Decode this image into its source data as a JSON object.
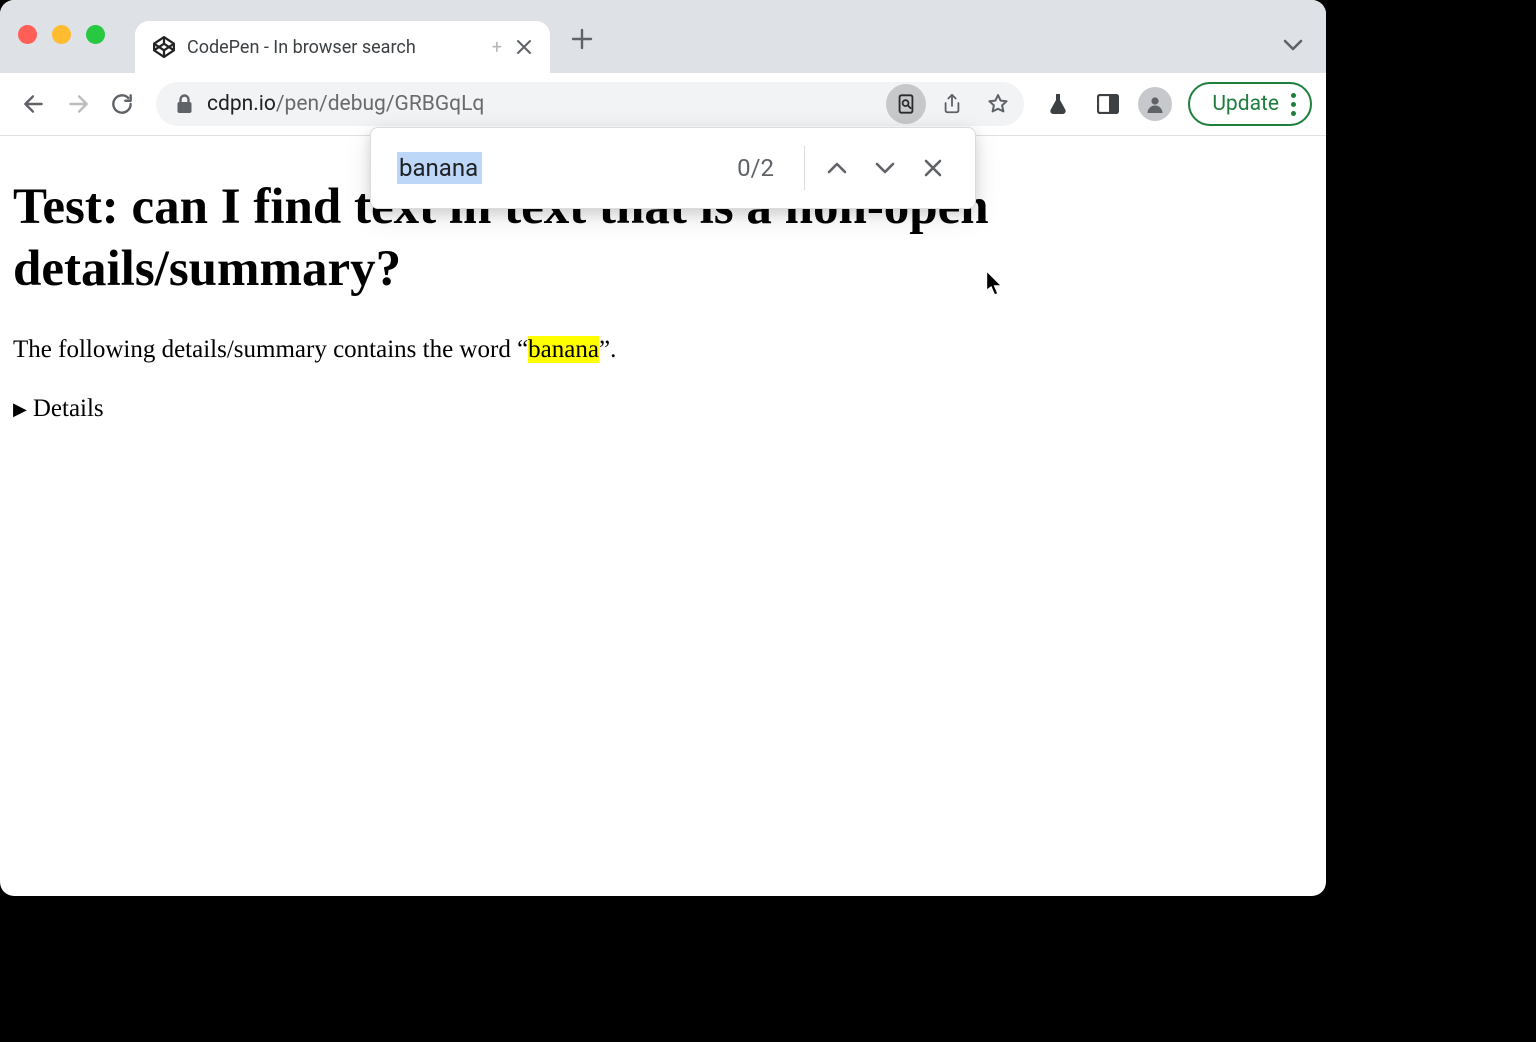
{
  "tab": {
    "title": "CodePen - In browser search"
  },
  "address": {
    "domain": "cdpn.io",
    "path": "/pen/debug/GRBGqLq"
  },
  "toolbar": {
    "update_label": "Update"
  },
  "find": {
    "query": "banana",
    "count": "0/2"
  },
  "page": {
    "heading": "Test: can I find text in text that is a non-open details/summary?",
    "para_prefix": "The following details/summary contains the word “",
    "para_highlight": "banana",
    "para_suffix": "”.",
    "details_summary": "Details"
  }
}
